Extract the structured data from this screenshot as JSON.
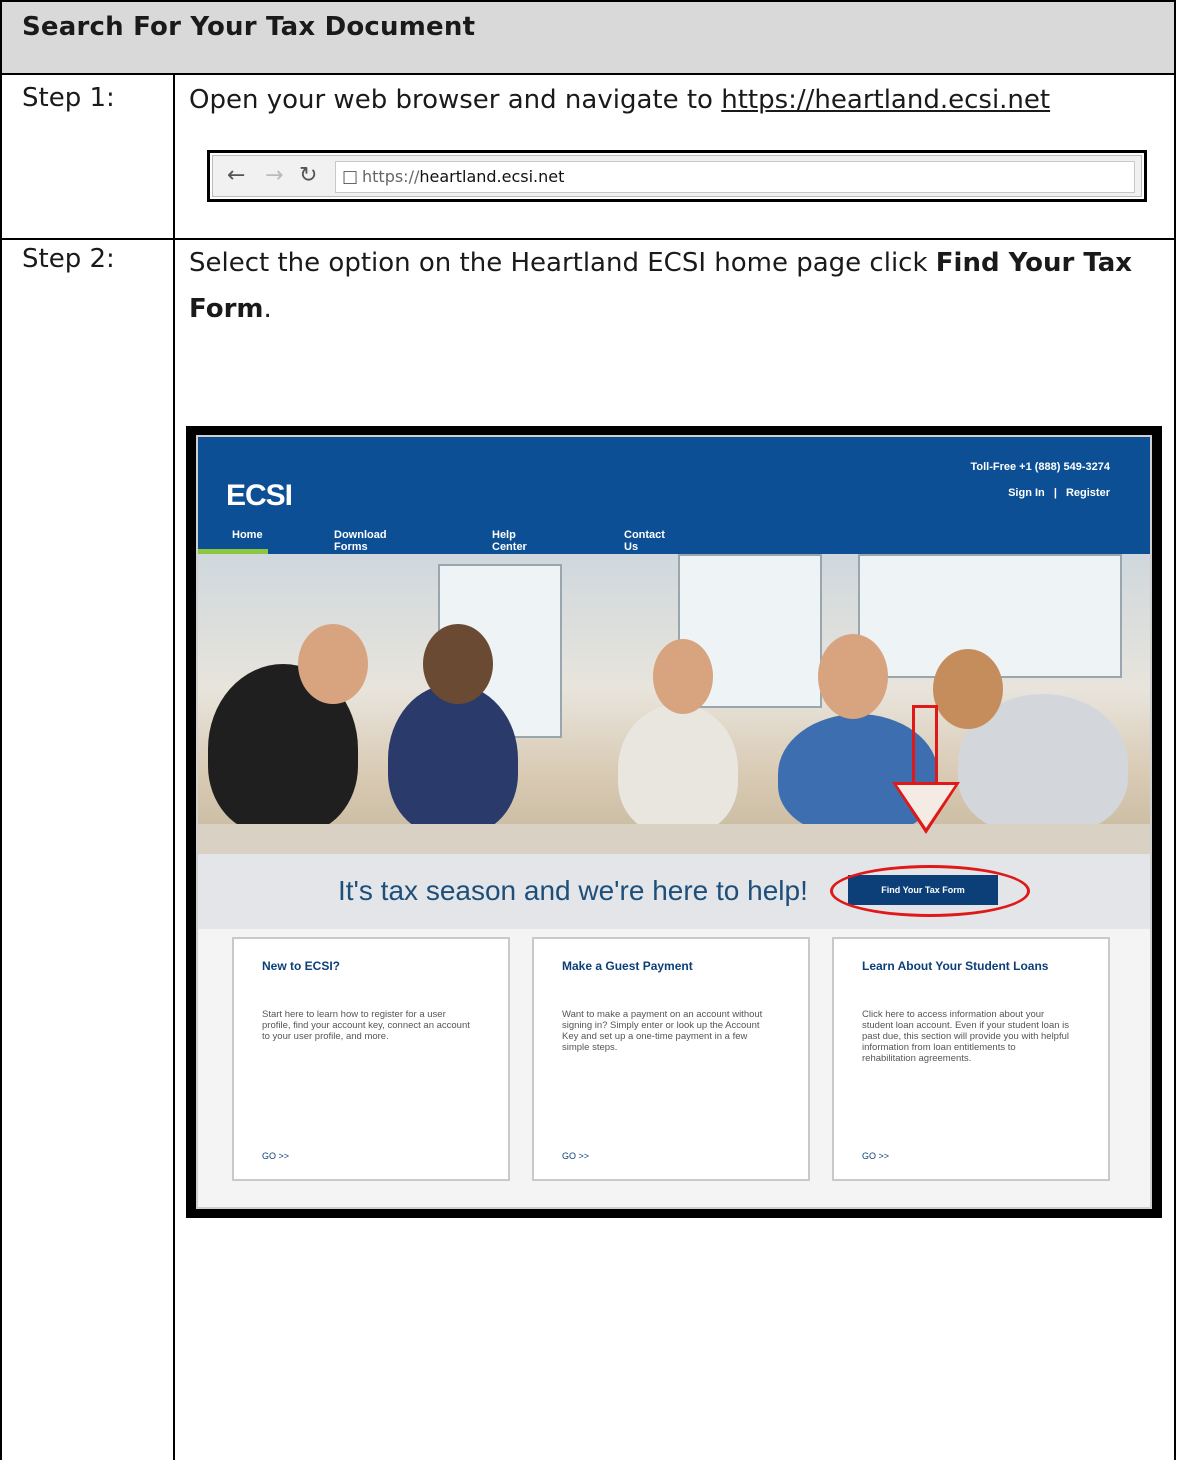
{
  "header": {
    "title": "Search For Your Tax Document"
  },
  "step1": {
    "label": "Step 1:",
    "text": "Open your web browser and navigate to ",
    "link": "https://heartland.ecsi.net",
    "browser": {
      "back_icon": "back-arrow-icon",
      "forward_icon": "forward-arrow-icon",
      "reload_icon": "reload-icon",
      "url_prefix": "https://",
      "url_host": "heartland.ecsi.net"
    }
  },
  "step2": {
    "label": "Step 2:",
    "text_before": "Select the option on the Heartland ECSI home page click ",
    "bold1": "Find Your Tax",
    "bold2": "Form",
    "period": ".",
    "screenshot": {
      "logo": "ECSI",
      "toll_free": "Toll-Free +1 (888) 549-3274",
      "sign_in": "Sign In",
      "separator": "|",
      "register": "Register",
      "nav": [
        "Home",
        "Download Forms",
        "Help Center",
        "Contact Us"
      ],
      "tagline": "It's tax season and we're here to help!",
      "find_button": "Find Your Tax Form",
      "cards": [
        {
          "title": "New to ECSI?",
          "body": "Start here to learn how to register for a user profile, find your account key, connect an account to your user profile, and more.",
          "go": "GO >>"
        },
        {
          "title": "Make a Guest Payment",
          "body": "Want to make a payment on an account without signing in? Simply enter or look up the Account Key and set up a one-time payment in a few simple steps.",
          "go": "GO >>"
        },
        {
          "title": "Learn About Your Student Loans",
          "body": "Click here to access information about your student loan account. Even if your student loan is past due, this section will provide you with helpful information from loan entitlements to rehabilitation agreements.",
          "go": "GO >>"
        }
      ]
    }
  },
  "colors": {
    "ecsi_blue": "#0c4f94",
    "annotation_red": "#e01818",
    "header_gray": "#d9d9d9"
  }
}
